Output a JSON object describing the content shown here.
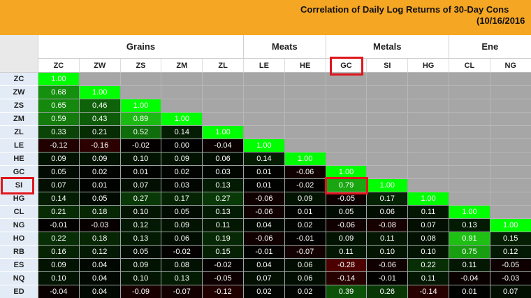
{
  "header": {
    "title_line1": "Correlation of Daily Log Returns of 30-Day Cons",
    "title_line2": "(10/16/2016"
  },
  "colors": {
    "banner": "#F5A623",
    "diagonal": "#00FF00",
    "positive_strong": "#1FBF1F",
    "neutral": "#000000",
    "negative": "#6B0000",
    "upper_triangle": "#A6A6A6",
    "row_header_bg": "#E3ECF6",
    "highlight": "#E0161D"
  },
  "groups": [
    {
      "label": "Grains",
      "span": 5
    },
    {
      "label": "Meats",
      "span": 2
    },
    {
      "label": "Metals",
      "span": 3
    },
    {
      "label": "Ene",
      "span": 2
    }
  ],
  "columns": [
    "ZC",
    "ZW",
    "ZS",
    "ZM",
    "ZL",
    "LE",
    "HE",
    "GC",
    "SI",
    "HG",
    "CL",
    "NG"
  ],
  "rows": [
    {
      "label": "ZC",
      "values": [
        "1.00"
      ]
    },
    {
      "label": "ZW",
      "values": [
        "0.68",
        "1.00"
      ]
    },
    {
      "label": "ZS",
      "values": [
        "0.65",
        "0.46",
        "1.00"
      ]
    },
    {
      "label": "ZM",
      "values": [
        "0.59",
        "0.43",
        "0.89",
        "1.00"
      ]
    },
    {
      "label": "ZL",
      "values": [
        "0.33",
        "0.21",
        "0.52",
        "0.14",
        "1.00"
      ]
    },
    {
      "label": "LE",
      "values": [
        "-0.12",
        "-0.16",
        "-0.02",
        "0.00",
        "-0.04",
        "1.00"
      ]
    },
    {
      "label": "HE",
      "values": [
        "0.09",
        "0.09",
        "0.10",
        "0.09",
        "0.06",
        "0.14",
        "1.00"
      ]
    },
    {
      "label": "GC",
      "values": [
        "0.05",
        "0.02",
        "0.01",
        "0.02",
        "0.03",
        "0.01",
        "-0.06",
        "1.00"
      ]
    },
    {
      "label": "SI",
      "values": [
        "0.07",
        "0.01",
        "0.07",
        "0.03",
        "0.13",
        "0.01",
        "-0.02",
        "0.79",
        "1.00"
      ]
    },
    {
      "label": "HG",
      "values": [
        "0.14",
        "0.05",
        "0.27",
        "0.17",
        "0.27",
        "-0.06",
        "0.09",
        "-0.05",
        "0.17",
        "1.00"
      ]
    },
    {
      "label": "CL",
      "values": [
        "0.21",
        "0.18",
        "0.10",
        "0.05",
        "0.13",
        "-0.06",
        "0.01",
        "0.05",
        "0.06",
        "0.11",
        "1.00"
      ]
    },
    {
      "label": "NG",
      "values": [
        "-0.01",
        "-0.03",
        "0.12",
        "0.09",
        "0.11",
        "0.04",
        "0.02",
        "-0.06",
        "-0.08",
        "0.07",
        "0.13",
        "1.00"
      ]
    },
    {
      "label": "HO",
      "values": [
        "0.22",
        "0.18",
        "0.13",
        "0.06",
        "0.19",
        "-0.06",
        "-0.01",
        "0.09",
        "0.11",
        "0.08",
        "0.91",
        "0.15"
      ]
    },
    {
      "label": "RB",
      "values": [
        "0.16",
        "0.12",
        "0.05",
        "-0.02",
        "0.15",
        "-0.01",
        "-0.07",
        "0.11",
        "0.10",
        "0.10",
        "0.75",
        "0.12"
      ]
    },
    {
      "label": "ES",
      "values": [
        "0.09",
        "0.04",
        "0.09",
        "0.08",
        "-0.02",
        "0.04",
        "0.06",
        "-0.28",
        "-0.06",
        "0.22",
        "0.11",
        "-0.05"
      ]
    },
    {
      "label": "NQ",
      "values": [
        "0.10",
        "0.04",
        "0.10",
        "0.13",
        "-0.05",
        "0.07",
        "0.06",
        "-0.14",
        "-0.01",
        "0.11",
        "-0.04",
        "-0.03"
      ]
    },
    {
      "label": "ED",
      "values": [
        "-0.04",
        "0.04",
        "-0.09",
        "-0.07",
        "-0.12",
        "0.02",
        "0.02",
        "0.39",
        "0.26",
        "-0.14",
        "0.01",
        "0.07"
      ]
    }
  ],
  "highlights": {
    "column": "GC",
    "row": "SI",
    "value_cell": {
      "row": "SI",
      "column": "GC"
    }
  }
}
